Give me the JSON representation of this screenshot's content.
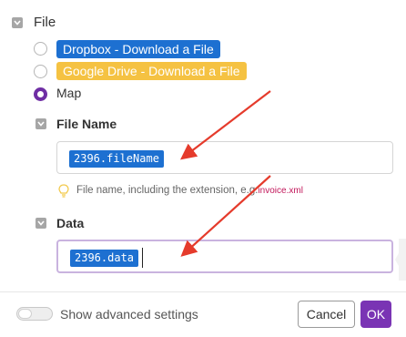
{
  "section": {
    "title": "File"
  },
  "options": [
    {
      "label": "Dropbox - Download a File",
      "color": "#1d70d1",
      "selected": false
    },
    {
      "label": "Google Drive - Download a File",
      "color": "#f5c242",
      "selected": false
    },
    {
      "label": "Map",
      "selected": true
    }
  ],
  "file_name": {
    "label": "File Name",
    "token": "2396.fileName",
    "hint": "File name, including the extension, e.g.",
    "hint_example": "invoice.xml"
  },
  "data_field": {
    "label": "Data",
    "token": "2396.data"
  },
  "footer": {
    "advanced_label": "Show advanced settings",
    "cancel_label": "Cancel",
    "ok_label": "OK"
  },
  "colors": {
    "accent": "#7a34b4",
    "token": "#1d70d1",
    "arrow": "#e53b2c"
  },
  "icons": [
    "collapse-checkbox-icon",
    "lightbulb-icon",
    "red-arrow-icon"
  ]
}
